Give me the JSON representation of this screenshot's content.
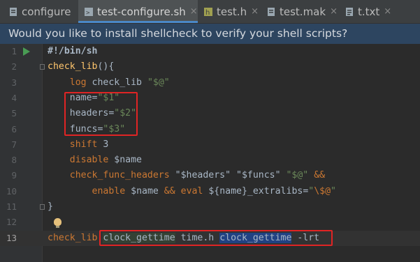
{
  "tabs": [
    {
      "label": "configure",
      "active": false,
      "icon": "file-icon"
    },
    {
      "label": "test-configure.sh",
      "active": true,
      "icon": "shell-file-icon"
    },
    {
      "label": "test.h",
      "active": false,
      "icon": "header-file-icon"
    },
    {
      "label": "test.mak",
      "active": false,
      "icon": "makefile-icon"
    },
    {
      "label": "t.txt",
      "active": false,
      "icon": "text-file-icon"
    }
  ],
  "close_glyph": "×",
  "banner": {
    "text": "Would you like to install shellcheck to verify your shell scripts?"
  },
  "line_numbers": [
    "1",
    "2",
    "3",
    "4",
    "5",
    "6",
    "7",
    "8",
    "9",
    "10",
    "11",
    "12",
    "13"
  ],
  "current_line": "13",
  "code": {
    "l1": {
      "shebang": "#!/bin/sh"
    },
    "l2": {
      "fn": "check_lib",
      "rest": "(){"
    },
    "l3": {
      "cmd": "log",
      "arg": " check_lib ",
      "str": "\"$@\""
    },
    "l4": {
      "var": "name",
      "eq": "=",
      "str": "\"$1\""
    },
    "l5": {
      "var": "headers",
      "eq": "=",
      "str": "\"$2\""
    },
    "l6": {
      "var": "funcs",
      "eq": "=",
      "str": "\"$3\""
    },
    "l7": {
      "kw": "shift",
      "num": "3"
    },
    "l8": {
      "cmd": "disable",
      "var": "$name"
    },
    "l9": {
      "cmd": "check_func_headers",
      "s1": "\"$headers\"",
      "s2": "\"$funcs\"",
      "s3": "\"$@\"",
      "op": "&&"
    },
    "l10": {
      "cmd": "enable",
      "var": "$name",
      "op": "&&",
      "kw": "eval",
      "brace": "${name}",
      "suffix": "_extralibs=",
      "s_open": "\"",
      "esc": "\\$@",
      "s_close": "\""
    },
    "l11": {
      "brace": "}"
    },
    "l12": {},
    "l13": {
      "cmd": "check_lib",
      "a1": "clock_gettime",
      "a2": "time.h",
      "a3": "clock_gettime",
      "a4": "-lrt"
    }
  },
  "colors": {
    "keyword": "#cc7832",
    "function": "#ffc66d",
    "string": "#6a8759",
    "variable": "#9876aa",
    "number": "#6897bb",
    "accent": "#4a88c7",
    "annotation": "#e02424"
  }
}
